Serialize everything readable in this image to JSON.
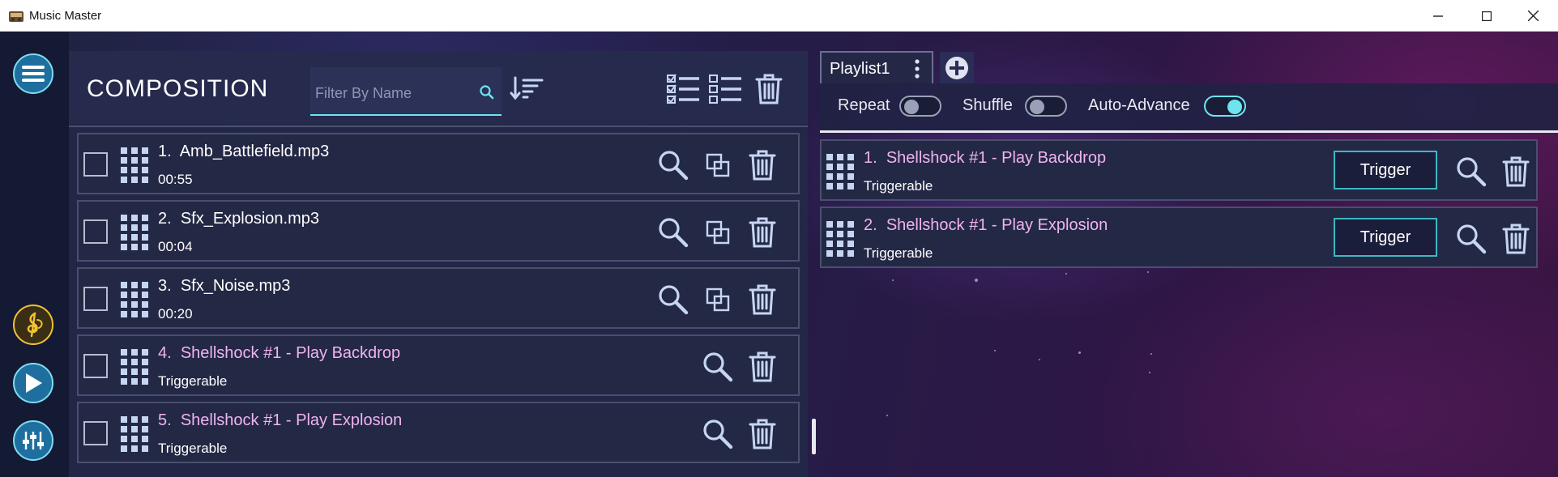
{
  "window": {
    "title": "Music Master"
  },
  "composition": {
    "title": "COMPOSITION",
    "filter_placeholder": "Filter By Name",
    "filter_value": "",
    "rows": [
      {
        "number": "1.",
        "name": "Amb_Battlefield.mp3",
        "sub": "00:55",
        "kind": "audio"
      },
      {
        "number": "2.",
        "name": "Sfx_Explosion.mp3",
        "sub": "00:04",
        "kind": "audio"
      },
      {
        "number": "3.",
        "name": "Sfx_Noise.mp3",
        "sub": "00:20",
        "kind": "audio"
      },
      {
        "number": "4.",
        "name": "Shellshock #1 - Play Backdrop",
        "sub": "Triggerable",
        "kind": "trigger"
      },
      {
        "number": "5.",
        "name": "Shellshock #1 - Play Explosion",
        "sub": "Triggerable",
        "kind": "trigger"
      }
    ]
  },
  "playlist": {
    "tab_label": "Playlist1",
    "toggles": [
      {
        "label": "Repeat",
        "on": false
      },
      {
        "label": "Shuffle",
        "on": false
      },
      {
        "label": "Auto-Advance",
        "on": true
      }
    ],
    "rows": [
      {
        "number": "1.",
        "name": "Shellshock #1 - Play Backdrop",
        "sub": "Triggerable",
        "button": "Trigger"
      },
      {
        "number": "2.",
        "name": "Shellshock #1 - Play Explosion",
        "sub": "Triggerable",
        "button": "Trigger"
      }
    ]
  },
  "colors": {
    "accent_cyan": "#6fe3ef",
    "trigger_pink": "#f0b4f0",
    "icon_blue": "#c6d6f2",
    "gold": "#f1c232"
  },
  "icons": {
    "menu": "hamburger-icon",
    "composer": "treble-clef-icon",
    "play": "play-icon",
    "mixer": "mixer-icon",
    "search": "search-icon",
    "sort": "sort-icon",
    "select_all": "checklist-icon",
    "list": "list-icon",
    "delete": "trash-icon",
    "duplicate": "copy-icon",
    "drag": "grip-icon",
    "add": "plus-circle-icon",
    "more": "kebab-icon"
  }
}
